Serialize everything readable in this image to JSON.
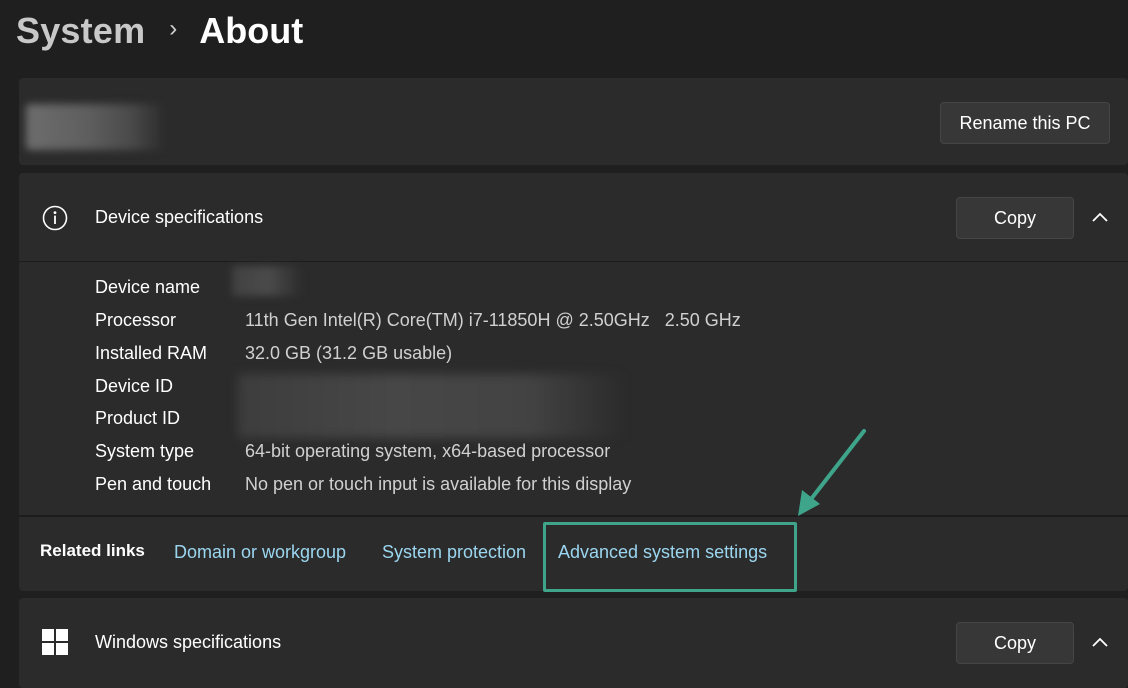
{
  "header": {
    "breadcrumb_parent": "System",
    "breadcrumb_separator": "›",
    "breadcrumb_current": "About"
  },
  "pc_card": {
    "rename_button_label": "Rename this PC"
  },
  "device_specs": {
    "title": "Device specifications",
    "copy_label": "Copy",
    "items": [
      {
        "label": "Device name",
        "value": ""
      },
      {
        "label": "Processor",
        "value": "11th Gen Intel(R) Core(TM) i7-11850H @ 2.50GHz   2.50 GHz"
      },
      {
        "label": "Installed RAM",
        "value": "32.0 GB (31.2 GB usable)"
      },
      {
        "label": "Device ID",
        "value": ""
      },
      {
        "label": "Product ID",
        "value": ""
      },
      {
        "label": "System type",
        "value": "64-bit operating system, x64-based processor"
      },
      {
        "label": "Pen and touch",
        "value": "No pen or touch input is available for this display"
      }
    ]
  },
  "related_links": {
    "label": "Related links",
    "links": [
      "Domain or workgroup",
      "System protection",
      "Advanced system settings"
    ]
  },
  "windows_specs": {
    "title": "Windows specifications",
    "copy_label": "Copy"
  },
  "icons": {
    "info": "info-icon",
    "chevron": "chevron-up-icon",
    "windows": "windows-logo-icon",
    "annotation_arrow": "arrow-icon"
  },
  "colors": {
    "background": "#1f1f1f",
    "card": "#2b2b2b",
    "link": "#9bd6f0",
    "annotation": "#3fa58a"
  }
}
